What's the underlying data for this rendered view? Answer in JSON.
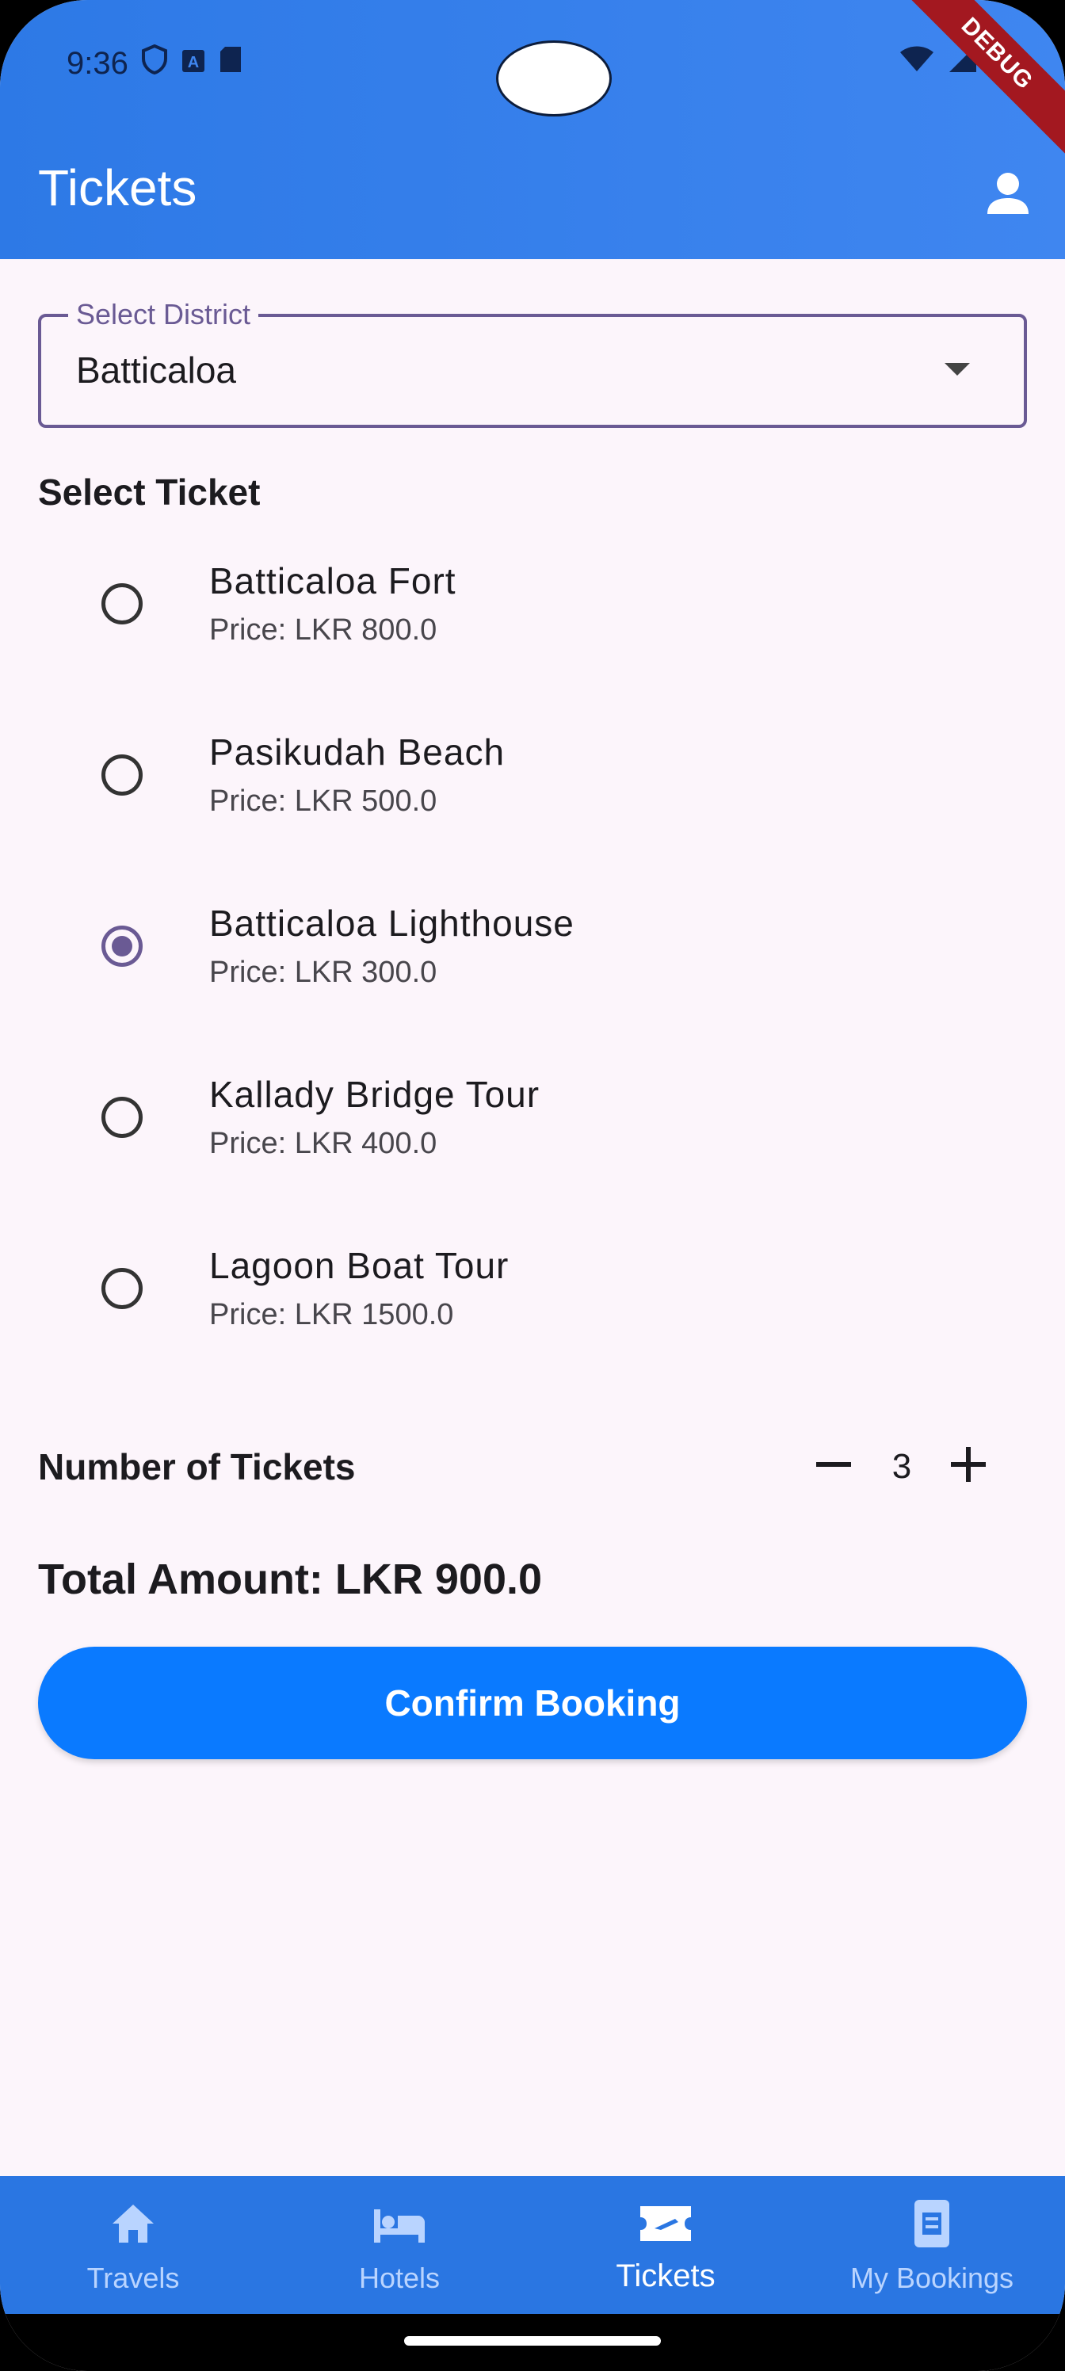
{
  "status_bar": {
    "time": "9:36"
  },
  "debug_label": "DEBUG",
  "app_bar": {
    "title": "Tickets"
  },
  "district": {
    "label": "Select District",
    "value": "Batticaloa"
  },
  "select_ticket_title": "Select Ticket",
  "tickets": [
    {
      "name": "Batticaloa Fort",
      "price": "Price: LKR 800.0",
      "selected": false
    },
    {
      "name": "Pasikudah Beach",
      "price": "Price: LKR 500.0",
      "selected": false
    },
    {
      "name": "Batticaloa Lighthouse",
      "price": "Price: LKR 300.0",
      "selected": true
    },
    {
      "name": "Kallady Bridge Tour",
      "price": "Price: LKR 400.0",
      "selected": false
    },
    {
      "name": "Lagoon Boat Tour",
      "price": "Price: LKR 1500.0",
      "selected": false
    }
  ],
  "quantity": {
    "label": "Number of Tickets",
    "value": "3"
  },
  "total": "Total Amount: LKR 900.0",
  "confirm_label": "Confirm Booking",
  "nav": [
    {
      "label": "Travels",
      "icon": "home-icon",
      "active": false
    },
    {
      "label": "Hotels",
      "icon": "bed-icon",
      "active": false
    },
    {
      "label": "Tickets",
      "icon": "airplane-ticket-icon",
      "active": true
    },
    {
      "label": "My Bookings",
      "icon": "booking-icon",
      "active": false
    }
  ],
  "colors": {
    "app_bar": "#3f86f0",
    "primary": "#0a7aff",
    "accent": "#6a5a94",
    "background": "#fcf5fb"
  }
}
